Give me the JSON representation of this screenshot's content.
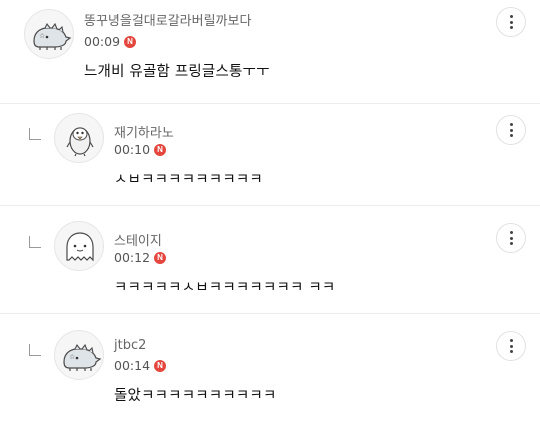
{
  "comments": [
    {
      "nickname": "똥꾸녕을걸대로갈라버릴까보다",
      "time": "00:09",
      "badge": "N",
      "text": "느개비 유골함 프링글스통ㅜㅜ",
      "avatar_icon": "dinosaur-avatar-icon",
      "is_reply": false
    },
    {
      "nickname": "재기하라노",
      "time": "00:10",
      "badge": "N",
      "text": "ㅅㅂㅋㅋㅋㅋㅋㅋㅋㅋㅋ",
      "avatar_icon": "penguin-avatar-icon",
      "is_reply": true
    },
    {
      "nickname": "스테이지",
      "time": "00:12",
      "badge": "N",
      "text": "ㅋㅋㅋㅋㅋㅅㅂㅋㅋㅋㅋㅋㅋㅋ ㅋㅋ",
      "avatar_icon": "ghost-avatar-icon",
      "is_reply": true
    },
    {
      "nickname": "jtbc2",
      "time": "00:14",
      "badge": "N",
      "text": "돌았ㅋㅋㅋㅋㅋㅋㅋㅋㅋㅋ",
      "avatar_icon": "dinosaur-avatar-icon",
      "is_reply": true
    }
  ],
  "colors": {
    "badge": "#e4463e",
    "nickname": "#666666",
    "divider": "#ececec"
  }
}
